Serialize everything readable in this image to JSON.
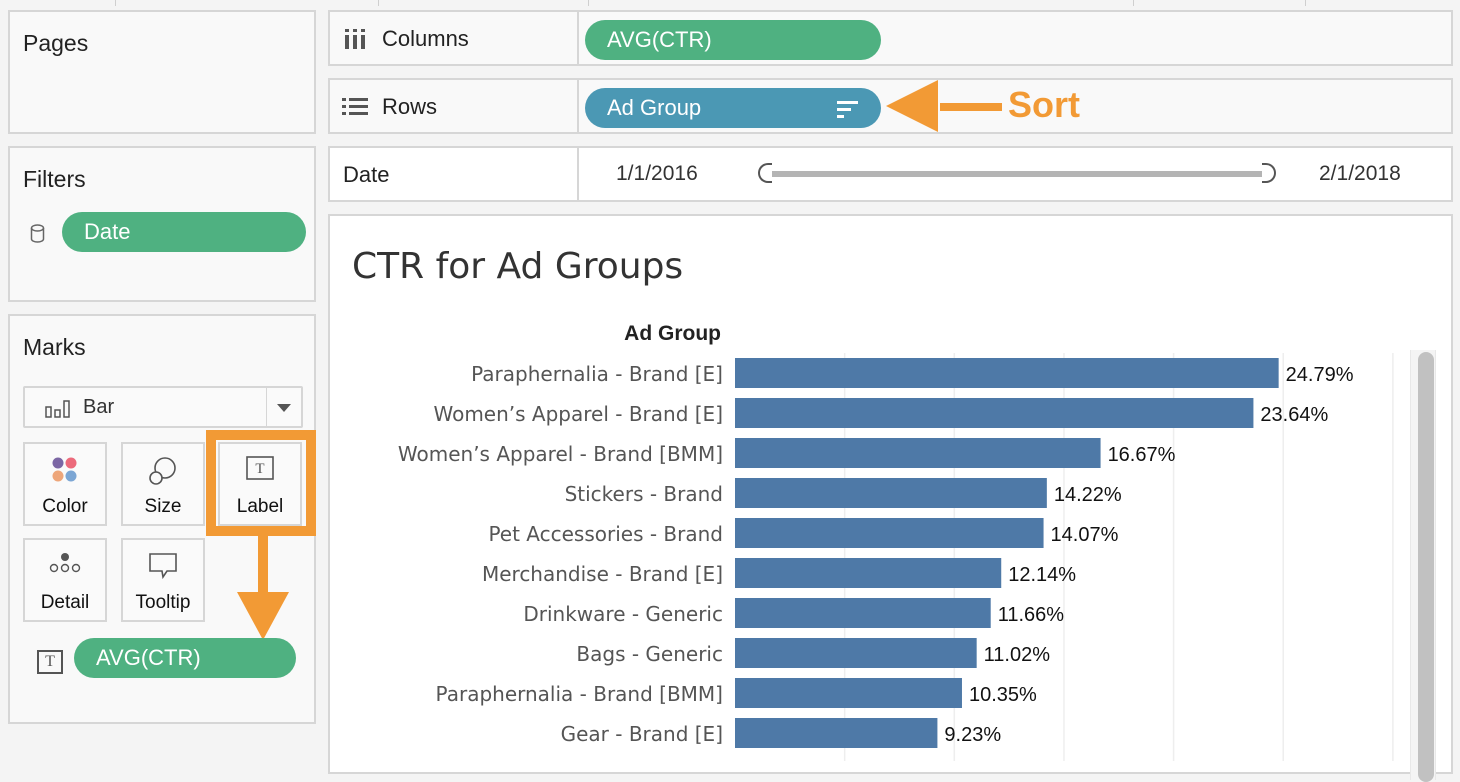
{
  "pages": {
    "title": "Pages"
  },
  "filters": {
    "title": "Filters",
    "pills": [
      {
        "label": "Date",
        "icon": "database-icon"
      }
    ]
  },
  "marks": {
    "title": "Marks",
    "mark_type": {
      "icon": "bar-chart-icon",
      "selected": "Bar"
    },
    "buttons": [
      {
        "label": "Color",
        "icon": "color-dots-icon"
      },
      {
        "label": "Size",
        "icon": "size-circles-icon"
      },
      {
        "label": "Label",
        "icon": "text-label-icon",
        "highlighted": true
      },
      {
        "label": "Detail",
        "icon": "detail-dots-icon"
      },
      {
        "label": "Tooltip",
        "icon": "speech-bubble-icon"
      }
    ],
    "fields": [
      {
        "label": "AVG(CTR)",
        "icon": "text-label-icon"
      }
    ]
  },
  "shelves": {
    "columns": {
      "label": "Columns",
      "icon": "columns-icon",
      "pill": "AVG(CTR)"
    },
    "rows": {
      "label": "Rows",
      "icon": "rows-icon",
      "pill": "Ad Group",
      "pill_icon": "sort-descending-icon"
    },
    "date": {
      "label": "Date",
      "start": "1/1/2016",
      "end": "2/1/2018",
      "range_fraction": [
        0,
        1
      ]
    }
  },
  "annotations": {
    "sort": "Sort"
  },
  "colors": {
    "measure_pill": "#4fb181",
    "dimension_pill": "#4b98b4",
    "bar": "#4e79a7",
    "annotation": "#f29a35"
  },
  "chart_data": {
    "type": "bar",
    "orientation": "horizontal",
    "title": "CTR for Ad Groups",
    "row_header": "Ad Group",
    "xlabel": "",
    "ylabel": "Ad Group",
    "xlim": [
      0,
      30
    ],
    "gridlines": [
      5,
      10,
      15,
      20,
      25,
      30
    ],
    "grid": true,
    "value_format": "percent",
    "categories": [
      "Paraphernalia - Brand [E]",
      "Women’s Apparel - Brand [E]",
      "Women’s Apparel - Brand [BMM]",
      "Stickers - Brand",
      "Pet Accessories - Brand",
      "Merchandise - Brand [E]",
      "Drinkware - Generic",
      "Bags - Generic",
      "Paraphernalia - Brand [BMM]",
      "Gear - Brand [E]"
    ],
    "values": [
      24.79,
      23.64,
      16.67,
      14.22,
      14.07,
      12.14,
      11.66,
      11.02,
      10.35,
      9.23
    ],
    "labels": [
      "24.79%",
      "23.64%",
      "16.67%",
      "14.22%",
      "14.07%",
      "12.14%",
      "11.66%",
      "11.02%",
      "10.35%",
      "9.23%"
    ]
  }
}
